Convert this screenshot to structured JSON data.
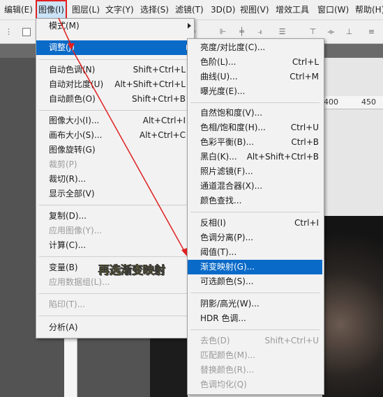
{
  "menubar": {
    "items": [
      "编辑(E)",
      "图像(I)",
      "图层(L)",
      "文字(Y)",
      "选择(S)",
      "滤镜(T)",
      "3D(D)",
      "视图(V)",
      "增效工具",
      "窗口(W)",
      "帮助(H)"
    ]
  },
  "toolbar": {
    "checkbox_icon": "checkbox-icon"
  },
  "ruler": {
    "label_400": "400",
    "label_450": "450"
  },
  "image_menu": {
    "items": [
      {
        "label": "模式(M)",
        "shortcut": "",
        "submenu": true,
        "disabled": false
      },
      {
        "label": "调整(J)",
        "shortcut": "",
        "submenu": true,
        "disabled": false
      },
      {
        "label": "自动色调(N)",
        "shortcut": "Shift+Ctrl+L",
        "submenu": false,
        "disabled": false
      },
      {
        "label": "自动对比度(U)",
        "shortcut": "Alt+Shift+Ctrl+L",
        "submenu": false,
        "disabled": false
      },
      {
        "label": "自动颜色(O)",
        "shortcut": "Shift+Ctrl+B",
        "submenu": false,
        "disabled": false
      },
      {
        "label": "图像大小(I)...",
        "shortcut": "Alt+Ctrl+I",
        "submenu": false,
        "disabled": false
      },
      {
        "label": "画布大小(S)...",
        "shortcut": "Alt+Ctrl+C",
        "submenu": false,
        "disabled": false
      },
      {
        "label": "图像旋转(G)",
        "shortcut": "",
        "submenu": true,
        "disabled": false
      },
      {
        "label": "裁剪(P)",
        "shortcut": "",
        "submenu": false,
        "disabled": true
      },
      {
        "label": "裁切(R)...",
        "shortcut": "",
        "submenu": false,
        "disabled": false
      },
      {
        "label": "显示全部(V)",
        "shortcut": "",
        "submenu": false,
        "disabled": false
      },
      {
        "label": "复制(D)...",
        "shortcut": "",
        "submenu": false,
        "disabled": false
      },
      {
        "label": "应用图像(Y)...",
        "shortcut": "",
        "submenu": false,
        "disabled": true
      },
      {
        "label": "计算(C)...",
        "shortcut": "",
        "submenu": false,
        "disabled": false
      },
      {
        "label": "变量(B)",
        "shortcut": "",
        "submenu": true,
        "disabled": false
      },
      {
        "label": "应用数据组(L)...",
        "shortcut": "",
        "submenu": false,
        "disabled": true
      },
      {
        "label": "陷印(T)...",
        "shortcut": "",
        "submenu": false,
        "disabled": true
      },
      {
        "label": "分析(A)",
        "shortcut": "",
        "submenu": true,
        "disabled": false
      }
    ]
  },
  "adjust_menu": {
    "items": [
      {
        "label": "亮度/对比度(C)...",
        "shortcut": "",
        "disabled": false
      },
      {
        "label": "色阶(L)...",
        "shortcut": "Ctrl+L",
        "disabled": false
      },
      {
        "label": "曲线(U)...",
        "shortcut": "Ctrl+M",
        "disabled": false
      },
      {
        "label": "曝光度(E)...",
        "shortcut": "",
        "disabled": false
      },
      {
        "label": "自然饱和度(V)...",
        "shortcut": "",
        "disabled": false
      },
      {
        "label": "色相/饱和度(H)...",
        "shortcut": "Ctrl+U",
        "disabled": false
      },
      {
        "label": "色彩平衡(B)...",
        "shortcut": "Ctrl+B",
        "disabled": false
      },
      {
        "label": "黑白(K)...",
        "shortcut": "Alt+Shift+Ctrl+B",
        "disabled": false
      },
      {
        "label": "照片滤镜(F)...",
        "shortcut": "",
        "disabled": false
      },
      {
        "label": "通道混合器(X)...",
        "shortcut": "",
        "disabled": false
      },
      {
        "label": "颜色查找...",
        "shortcut": "",
        "disabled": false
      },
      {
        "label": "反相(I)",
        "shortcut": "Ctrl+I",
        "disabled": false
      },
      {
        "label": "色调分离(P)...",
        "shortcut": "",
        "disabled": false
      },
      {
        "label": "阈值(T)...",
        "shortcut": "",
        "disabled": false
      },
      {
        "label": "渐变映射(G)...",
        "shortcut": "",
        "disabled": false
      },
      {
        "label": "可选颜色(S)...",
        "shortcut": "",
        "disabled": false
      },
      {
        "label": "阴影/高光(W)...",
        "shortcut": "",
        "disabled": false
      },
      {
        "label": "HDR 色调...",
        "shortcut": "",
        "disabled": false
      },
      {
        "label": "去色(D)",
        "shortcut": "Shift+Ctrl+U",
        "disabled": true
      },
      {
        "label": "匹配颜色(M)...",
        "shortcut": "",
        "disabled": true
      },
      {
        "label": "替换颜色(R)...",
        "shortcut": "",
        "disabled": true
      },
      {
        "label": "色调均化(Q)",
        "shortcut": "",
        "disabled": true
      }
    ]
  },
  "annotation": {
    "callout": "再选渐变映射"
  },
  "colors": {
    "highlight": "#0a6ac8",
    "annotation_red": "#e02020",
    "callout_yellow": "#ffe600"
  }
}
